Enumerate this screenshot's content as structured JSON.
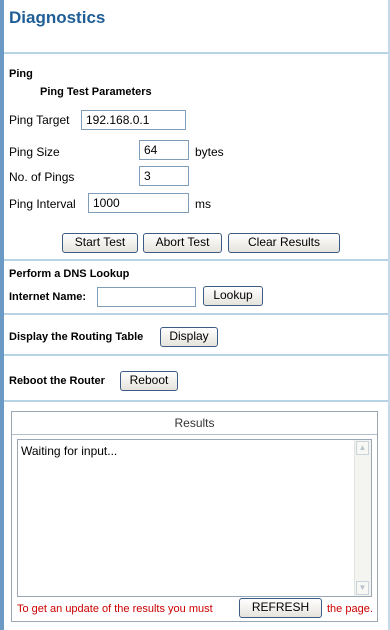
{
  "page": {
    "title": "Diagnostics"
  },
  "ping": {
    "section_label": "Ping",
    "params_heading": "Ping Test Parameters",
    "target_label": "Ping Target",
    "target_value": "192.168.0.1",
    "size_label": "Ping Size",
    "size_value": "64",
    "size_unit": "bytes",
    "count_label": "No. of Pings",
    "count_value": "3",
    "interval_label": "Ping Interval",
    "interval_value": "1000",
    "interval_unit": "ms",
    "start_button": "Start Test",
    "abort_button": "Abort Test",
    "clear_button": "Clear Results"
  },
  "dns": {
    "section_label": "Perform a DNS Lookup",
    "name_label": "Internet Name:",
    "name_value": "",
    "lookup_button": "Lookup"
  },
  "routing": {
    "label": "Display the Routing Table",
    "button": "Display"
  },
  "reboot": {
    "label": "Reboot the Router",
    "button": "Reboot"
  },
  "results": {
    "header": "Results",
    "text": "Waiting for input...",
    "note_before": "To get an update of the results you must",
    "refresh_button": "REFRESH",
    "note_after": "the page."
  },
  "icons": {
    "scroll_up": "scroll-up-arrow",
    "scroll_down": "scroll-down-arrow"
  }
}
